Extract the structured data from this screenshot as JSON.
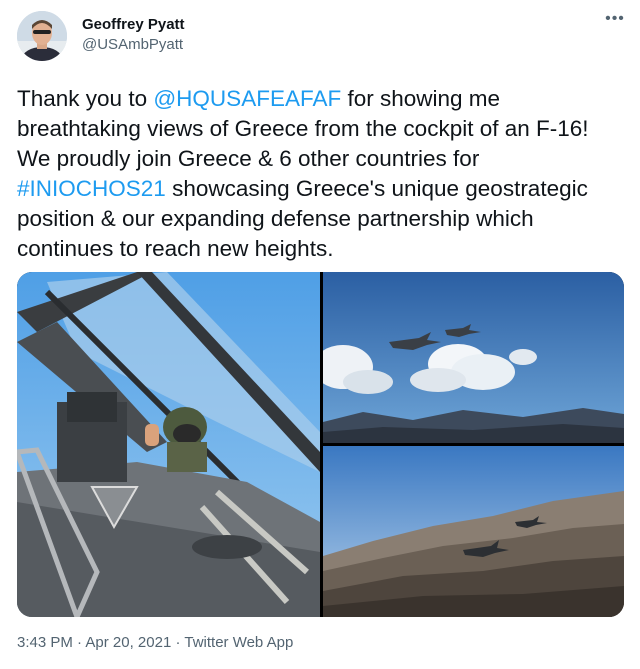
{
  "user": {
    "display_name": "Geoffrey Pyatt",
    "handle": "@USAmbPyatt"
  },
  "tweet": {
    "text_1": "Thank you to ",
    "mention": "@HQUSAFEAFAF",
    "text_2": " for showing me breathtaking views of Greece from the cockpit of an F-16! We proudly join Greece & 6 other countries for ",
    "hashtag": "#INIOCHOS21",
    "text_3": " showcasing Greece's unique geostrategic position & our expanding defense partnership which continues to reach new heights."
  },
  "meta": {
    "time": "3:43 PM",
    "sep1": " · ",
    "date": "Apr 20, 2021",
    "sep2": " · ",
    "source": "Twitter Web App"
  },
  "media": {
    "photo_left_desc": "pilot-in-cockpit",
    "photo_top_right_desc": "jets-above-clouds",
    "photo_bottom_right_desc": "jets-over-mountains"
  },
  "colors": {
    "link": "#1d9bf0",
    "secondary_text": "#536471",
    "primary_text": "#0f1419"
  },
  "icons": {
    "more": "more-horizontal-icon"
  }
}
